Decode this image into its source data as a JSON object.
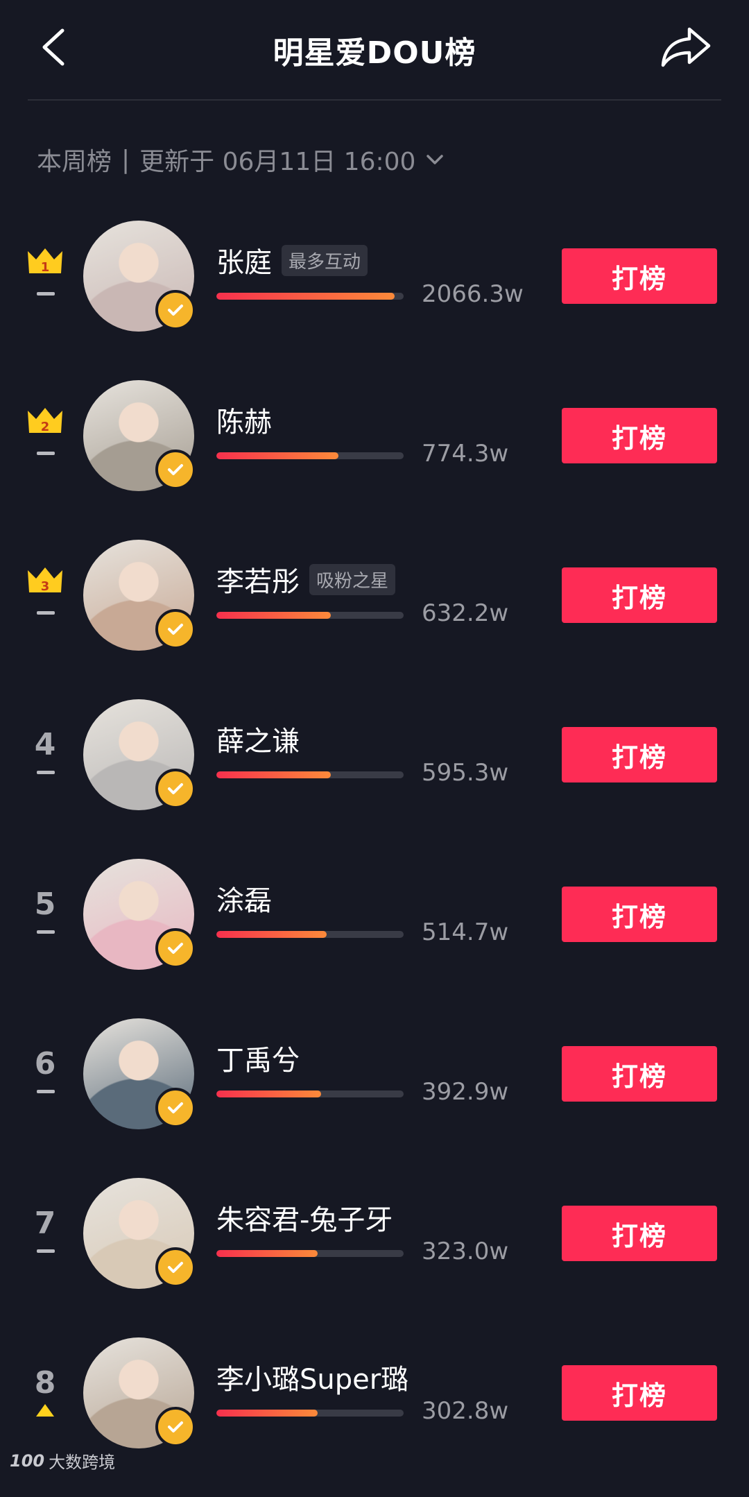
{
  "header": {
    "title": "明星爱DOU榜",
    "back_icon": "chevron-left-icon",
    "share_icon": "share-arrow-icon"
  },
  "period": {
    "label": "本周榜",
    "separator": "|",
    "updated": "更新于 06月11日 16:00",
    "dropdown_icon": "chevron-down-icon"
  },
  "colors": {
    "background": "#161823",
    "button": "#fe2c55",
    "crown": "#ffcc1f",
    "verify": "#f6b52b"
  },
  "ranking": [
    {
      "rank": "1",
      "crown": true,
      "trend": "flat",
      "name": "张庭",
      "tag": "最多互动",
      "score": "2066.3w",
      "progress": 0.95,
      "button": "打榜",
      "avatar_bg": "#c9b7b4"
    },
    {
      "rank": "2",
      "crown": true,
      "trend": "flat",
      "name": "陈赫",
      "tag": "",
      "score": "774.3w",
      "progress": 0.65,
      "button": "打榜",
      "avatar_bg": "#a59d92"
    },
    {
      "rank": "3",
      "crown": true,
      "trend": "flat",
      "name": "李若彤",
      "tag": "吸粉之星",
      "score": "632.2w",
      "progress": 0.61,
      "button": "打榜",
      "avatar_bg": "#c8a995"
    },
    {
      "rank": "4",
      "crown": false,
      "trend": "flat",
      "name": "薛之谦",
      "tag": "",
      "score": "595.3w",
      "progress": 0.61,
      "button": "打榜",
      "avatar_bg": "#b9b7b6"
    },
    {
      "rank": "5",
      "crown": false,
      "trend": "flat",
      "name": "涂磊",
      "tag": "",
      "score": "514.7w",
      "progress": 0.59,
      "button": "打榜",
      "avatar_bg": "#e8b7c2"
    },
    {
      "rank": "6",
      "crown": false,
      "trend": "flat",
      "name": "丁禹兮",
      "tag": "",
      "score": "392.9w",
      "progress": 0.56,
      "button": "打榜",
      "avatar_bg": "#5a6b7a"
    },
    {
      "rank": "7",
      "crown": false,
      "trend": "flat",
      "name": "朱容君-兔子牙",
      "tag": "",
      "score": "323.0w",
      "progress": 0.54,
      "button": "打榜",
      "avatar_bg": "#d8c9b6"
    },
    {
      "rank": "8",
      "crown": false,
      "trend": "up",
      "name": "李小璐Super璐",
      "tag": "",
      "score": "302.8w",
      "progress": 0.54,
      "button": "打榜",
      "avatar_bg": "#b7a594"
    }
  ],
  "watermark": {
    "mark": "100",
    "text": "大数跨境"
  }
}
